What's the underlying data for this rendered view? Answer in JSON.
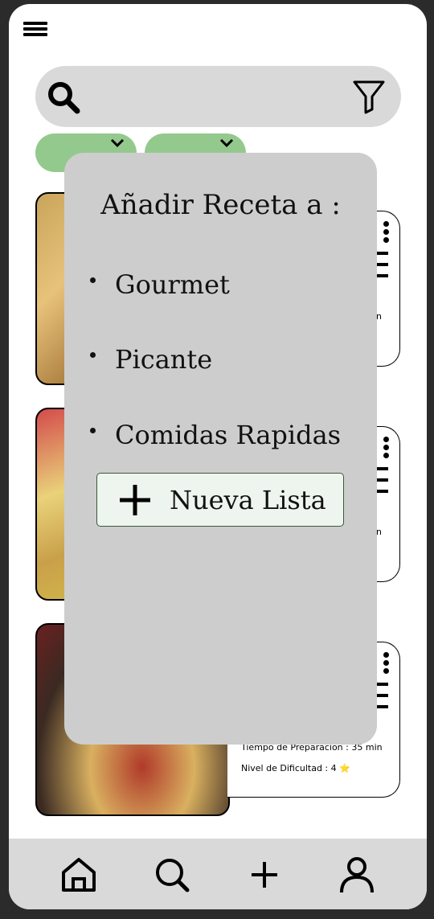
{
  "search": {
    "placeholder": ""
  },
  "recipes": [
    {
      "partial_meta": "n"
    },
    {
      "partial_meta": "n"
    },
    {
      "prep_time": "Tiempo de Preparacion : 35 min",
      "difficulty": "Nivel de Dificultad : 4 ⭐"
    }
  ],
  "popup": {
    "title": "Añadir Receta a :",
    "options": [
      "Gourmet",
      "Picante",
      "Comidas Rapidas"
    ],
    "new_list_label": "Nueva Lista"
  },
  "colors": {
    "chip": "#93c98d",
    "search_bg": "#d9d9d9",
    "popup_bg": "#cdcdcd",
    "tab_bar_bg": "#d9d9d9",
    "new_list_bg": "#eef4ee"
  },
  "icons": {
    "menu": "hamburger-icon",
    "search": "search-icon",
    "filter": "filter-icon",
    "chip_remove": "close-icon",
    "card_menu": "more-vertical-icon",
    "tabs": [
      "home-icon",
      "search-icon",
      "plus-icon",
      "user-icon"
    ],
    "new_list": "plus-icon"
  }
}
